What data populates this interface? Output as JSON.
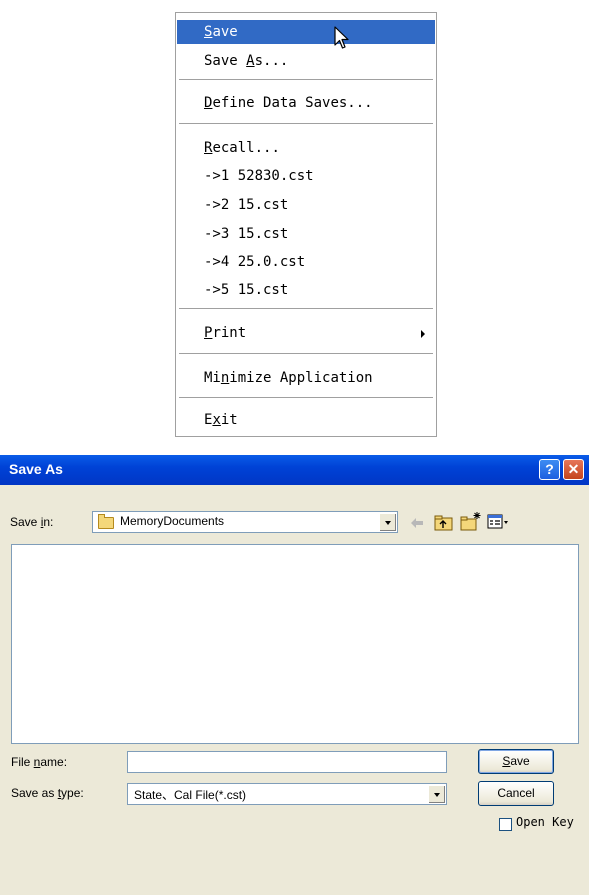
{
  "menu": {
    "items": [
      {
        "pre": "",
        "key": "S",
        "post": "ave"
      },
      {
        "pre": "Save ",
        "key": "A",
        "post": "s..."
      },
      {
        "pre": "",
        "key": "D",
        "post": "efine Data Saves..."
      },
      {
        "pre": "",
        "key": "R",
        "post": "ecall..."
      },
      {
        "pre": "->1 52830.cst",
        "key": "",
        "post": ""
      },
      {
        "pre": "->2 15.cst",
        "key": "",
        "post": ""
      },
      {
        "pre": "->3 15.cst",
        "key": "",
        "post": ""
      },
      {
        "pre": "->4 25.0.cst",
        "key": "",
        "post": ""
      },
      {
        "pre": "->5 15.cst",
        "key": "",
        "post": ""
      },
      {
        "pre": "",
        "key": "P",
        "post": "rint"
      },
      {
        "pre": "Mi",
        "key": "n",
        "post": "imize Application"
      },
      {
        "pre": "E",
        "key": "x",
        "post": "it"
      }
    ],
    "selected_color": "#316ac5"
  },
  "dialog": {
    "title": "Save As",
    "help_glyph": "?",
    "close_glyph": "✕",
    "save_in": {
      "pre": "Save ",
      "key": "i",
      "post": "n:"
    },
    "folder": "MemoryDocuments",
    "file_name_label": {
      "pre": "File ",
      "key": "n",
      "post": "ame:"
    },
    "file_name_value": "",
    "save_as_type_label": {
      "pre": "Save as ",
      "key": "t",
      "post": "ype:"
    },
    "save_as_type_value": "State、Cal File(*.cst)",
    "save_button": {
      "pre": "",
      "key": "S",
      "post": "ave"
    },
    "cancel_button": "Cancel",
    "open_key_label": "Open Key",
    "toolbar_icons": [
      "back-arrow-icon",
      "up-folder-icon",
      "new-folder-icon",
      "views-menu-icon"
    ],
    "title_color": "#0042d6"
  }
}
